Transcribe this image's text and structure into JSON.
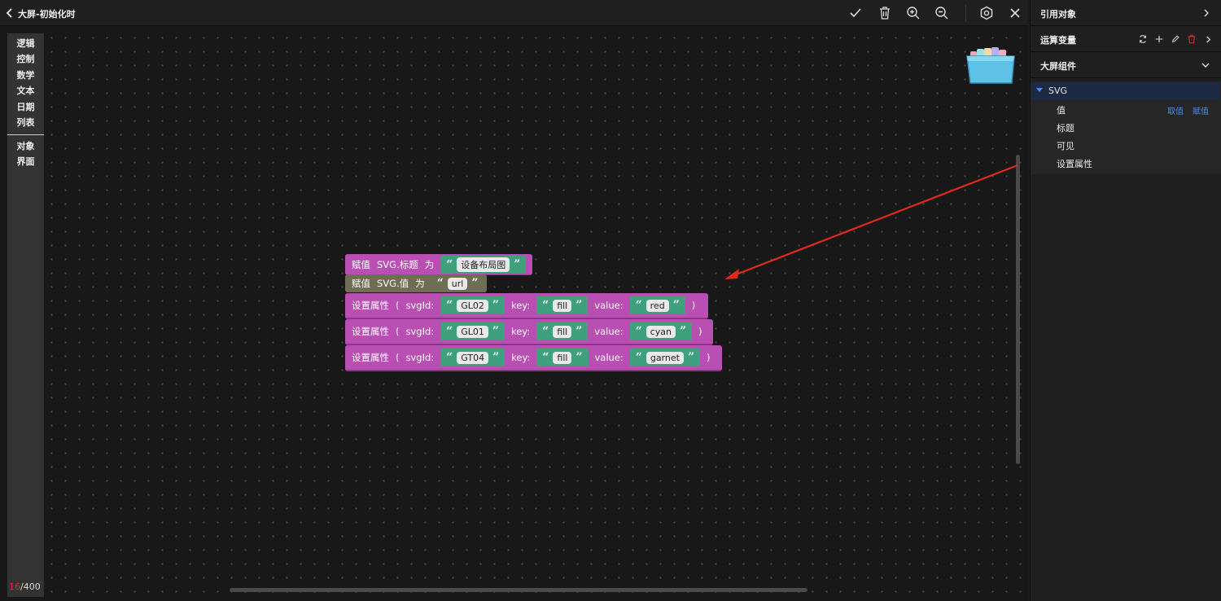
{
  "header": {
    "title": "大屏-初始化时",
    "back_icon": "chevron-left-icon",
    "tools": [
      "check-icon",
      "trash-icon",
      "zoom-in-icon",
      "zoom-out-icon",
      "settings-icon",
      "close-icon"
    ]
  },
  "toolbox": {
    "categories": [
      "逻辑",
      "控制",
      "数学",
      "文本",
      "日期",
      "列表"
    ],
    "extra_categories": [
      "对象",
      "界面"
    ]
  },
  "counter": {
    "used": "16",
    "total": "/400"
  },
  "blocks": {
    "assign_title": {
      "label": "赋值",
      "target": "SVG.标题",
      "op": "为",
      "value": "设备布局图"
    },
    "assign_value": {
      "label": "赋值",
      "target": "SVG.值",
      "op": "为",
      "value": "url"
    },
    "set_attrs": [
      {
        "label": "设置属性",
        "open": "(",
        "svgid_label": "svgId:",
        "svgid": "GL02",
        "key_label": "key:",
        "key": "fill",
        "value_label": "value:",
        "value": "red",
        "close": ")"
      },
      {
        "label": "设置属性",
        "open": "(",
        "svgid_label": "svgId:",
        "svgid": "GL01",
        "key_label": "key:",
        "key": "fill",
        "value_label": "value:",
        "value": "cyan",
        "close": ")"
      },
      {
        "label": "设置属性",
        "open": "(",
        "svgid_label": "svgId:",
        "svgid": "GT04",
        "key_label": "key:",
        "key": "fill",
        "value_label": "value:",
        "value": "garnet",
        "close": ")"
      }
    ],
    "quote_open": "“",
    "quote_close": "”"
  },
  "panel": {
    "ref_objects": "引用对象",
    "computed_vars": "运算变量",
    "screen_components": "大屏组件",
    "tree": {
      "root": "SVG",
      "children": [
        "值",
        "标题",
        "可见",
        "设置属性"
      ],
      "value_actions": [
        "取值",
        "赋值"
      ]
    }
  },
  "colors": {
    "block_pink": "#b94fb3",
    "block_olive": "#6f6d53",
    "string_green": "#3fa07e",
    "accent_blue": "#4a8ee8",
    "arrow_red": "#e02a1c"
  }
}
